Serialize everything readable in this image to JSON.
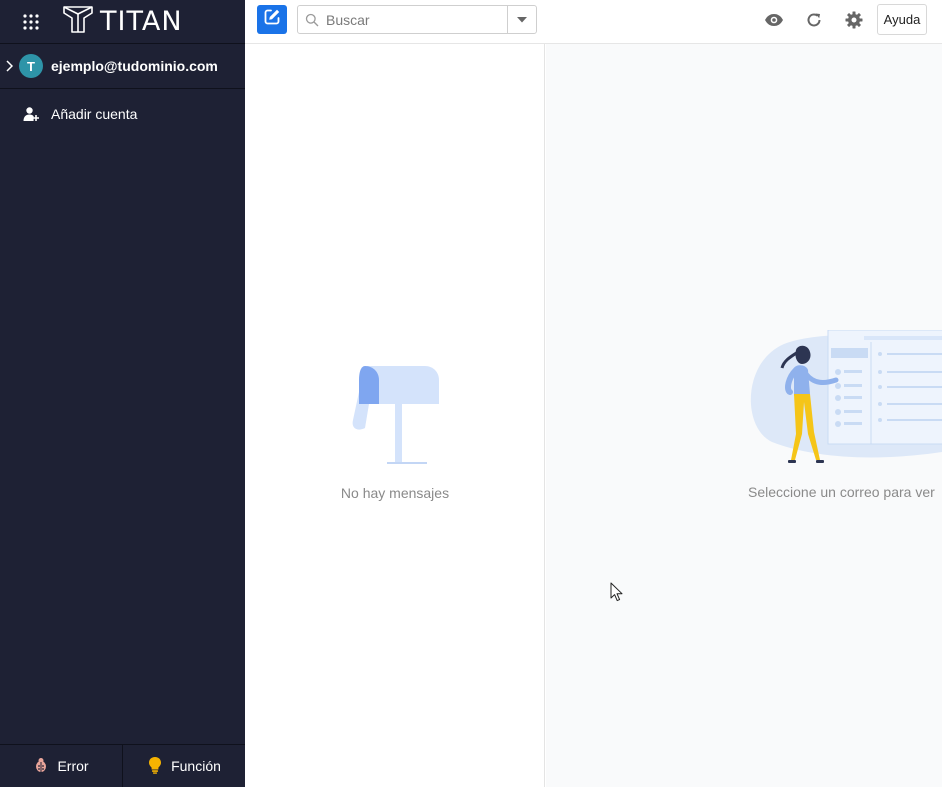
{
  "app": {
    "brand": "TITAN",
    "icons": {
      "apps": "apps-grid-icon",
      "logo": "titan-logo-icon"
    }
  },
  "sidebar": {
    "account": {
      "avatar_letter": "T",
      "email": "ejemplo@tudominio.com",
      "avatar_color": "#2e94a8"
    },
    "add_account_label": "Añadir cuenta",
    "footer": {
      "error_label": "Error",
      "feature_label": "Función"
    },
    "bg_color": "#1e2134"
  },
  "toolbar": {
    "search_placeholder": "Buscar",
    "help_label": "Ayuda",
    "accent_color": "#1a73e8",
    "icons": [
      "compose-icon",
      "search-icon",
      "chevron-down-icon",
      "eye-icon",
      "refresh-icon",
      "gear-icon"
    ]
  },
  "list": {
    "empty_text": "No hay mensajes"
  },
  "reader": {
    "empty_text": "Seleccione un correo para ver"
  }
}
